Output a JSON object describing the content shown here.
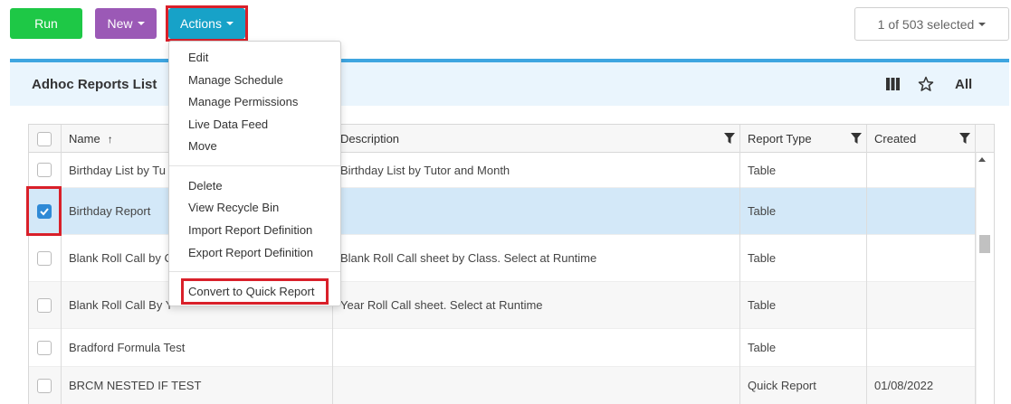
{
  "toolbar": {
    "run_label": "Run",
    "new_label": "New",
    "actions_label": "Actions",
    "selection_label": "1 of 503 selected"
  },
  "panel": {
    "title": "Adhoc Reports List",
    "all_label": "All"
  },
  "grid": {
    "columns": [
      "Name",
      "Description",
      "Report Type",
      "Created"
    ],
    "rows": [
      {
        "name": "Birthday List by Tu",
        "description": "Birthday List by Tutor and Month",
        "type": "Table",
        "created": "",
        "checked": false
      },
      {
        "name": "Birthday Report",
        "description": "",
        "type": "Table",
        "created": "",
        "checked": true
      },
      {
        "name": "Blank Roll Call by C",
        "description": "Blank Roll Call sheet by Class. Select at Runtime",
        "type": "Table",
        "created": "",
        "checked": false
      },
      {
        "name": "Blank Roll Call By Y",
        "description": "Year Roll Call sheet. Select at Runtime",
        "type": "Table",
        "created": "",
        "checked": false
      },
      {
        "name": "Bradford Formula Test",
        "description": "",
        "type": "Table",
        "created": "",
        "checked": false
      },
      {
        "name": "BRCM NESTED IF TEST",
        "description": "",
        "type": "Quick Report",
        "created": "01/08/2022",
        "checked": false
      }
    ]
  },
  "actions_menu": {
    "group1": [
      "Edit",
      "Manage Schedule",
      "Manage Permissions",
      "Live Data Feed",
      "Move"
    ],
    "group2": [
      "Delete",
      "View Recycle Bin",
      "Import Report Definition",
      "Export Report Definition"
    ],
    "group3": [
      "Convert to Quick Report"
    ]
  },
  "colors": {
    "run": "#1ec846",
    "new": "#9b59b6",
    "actions": "#17a2c8",
    "highlight": "#d9202a",
    "selected_row": "#d3e8f8"
  }
}
